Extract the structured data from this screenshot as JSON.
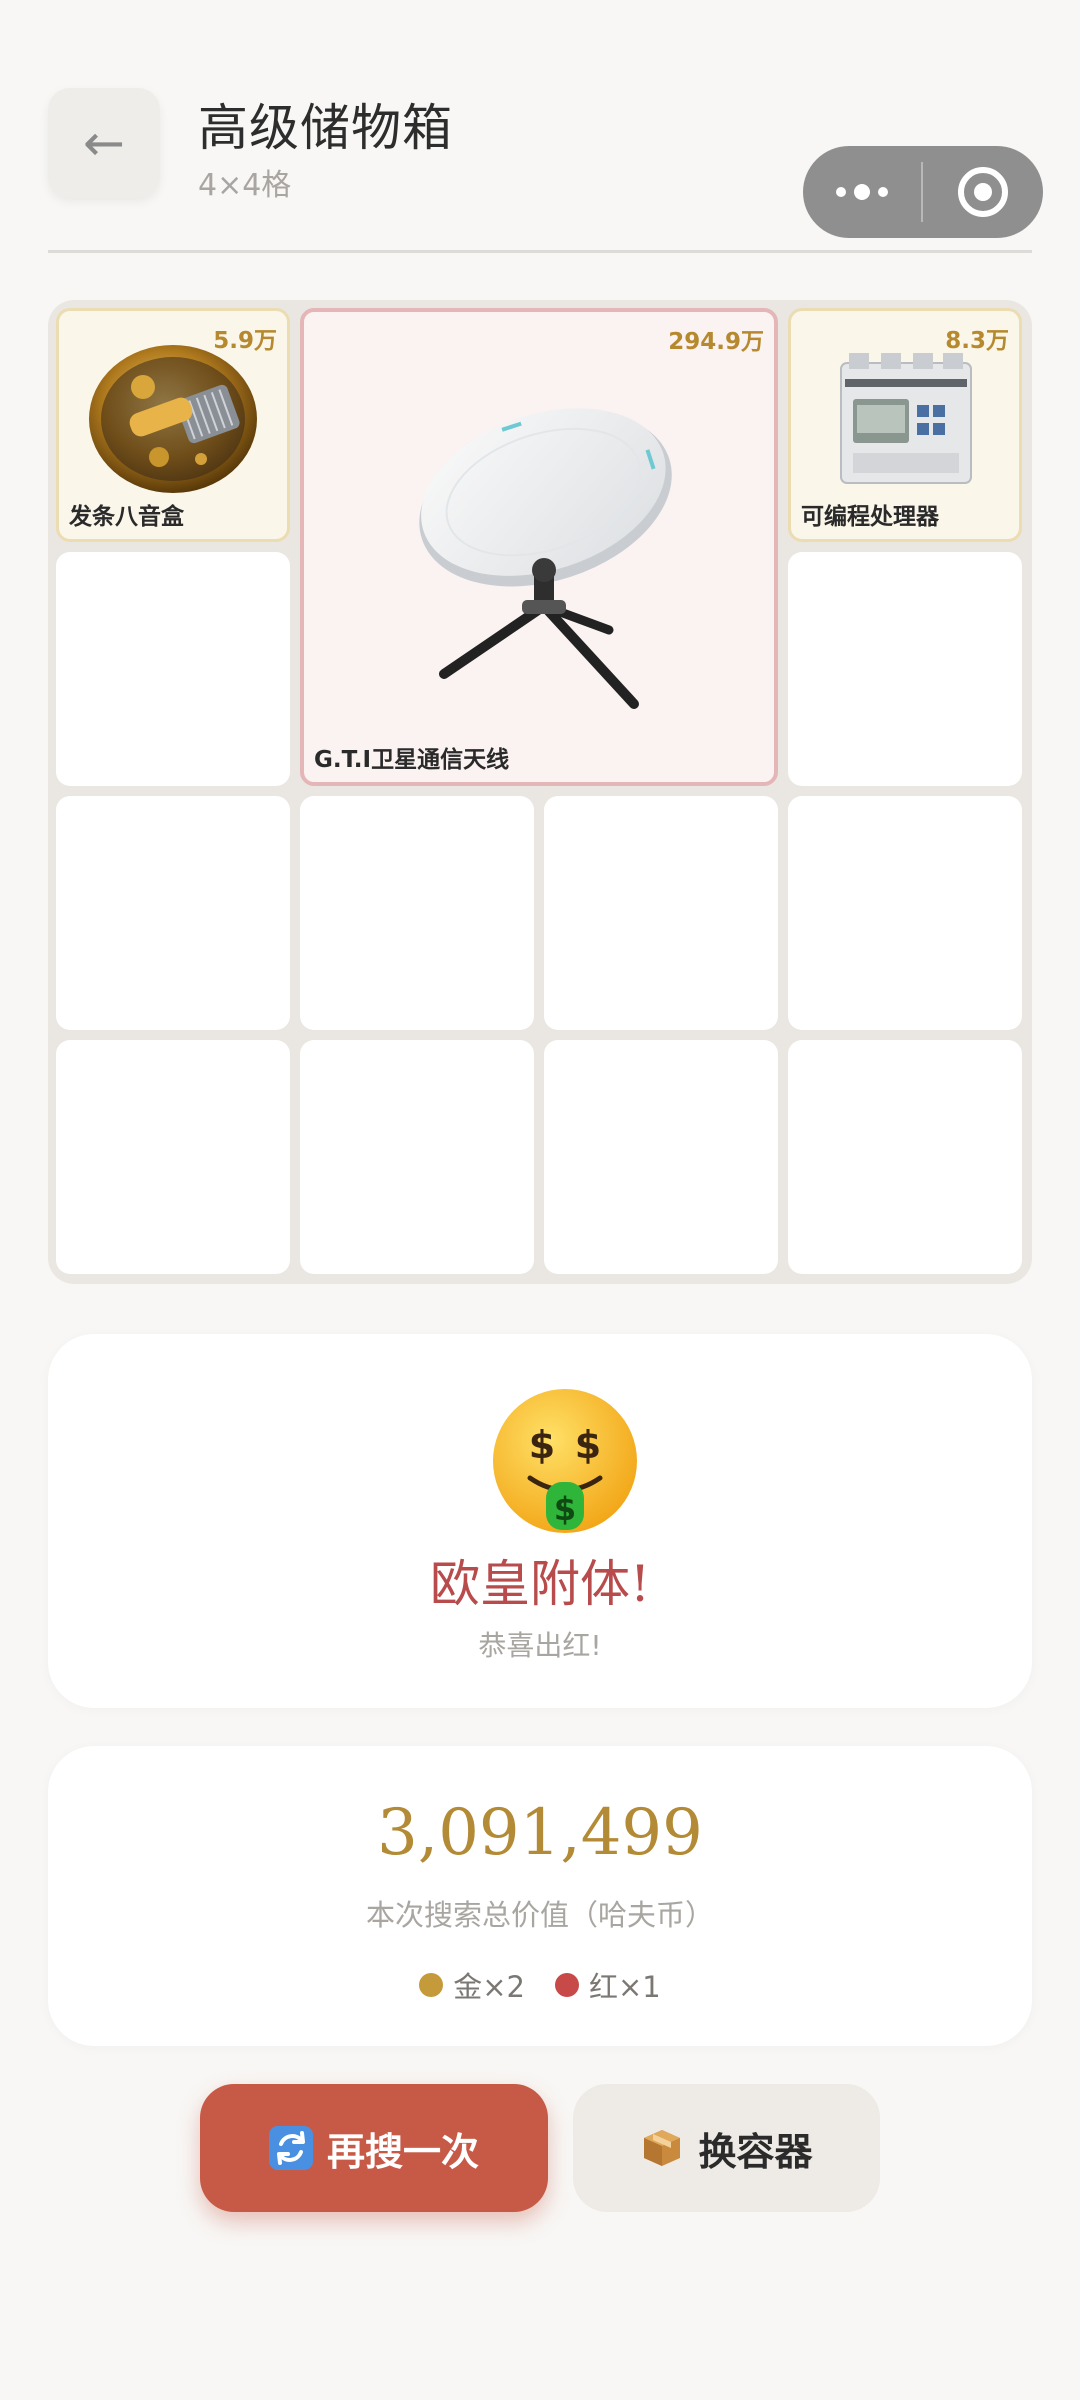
{
  "header": {
    "back_icon": "←",
    "title": "高级储物箱",
    "subtitle": "4×4格"
  },
  "grid": {
    "rows": 4,
    "cols": 4,
    "items": [
      {
        "name": "发条八音盒",
        "price": "5.9万",
        "rarity": "gold",
        "icon": "music-box-icon"
      },
      {
        "name": "G.T.I卫星通信天线",
        "price": "294.9万",
        "rarity": "red",
        "icon": "satellite-antenna-icon"
      },
      {
        "name": "可编程处理器",
        "price": "8.3万",
        "rarity": "gold",
        "icon": "processor-icon"
      }
    ]
  },
  "result": {
    "emoji": "money-mouth-face-icon",
    "title": "欧皇附体!",
    "subtitle": "恭喜出红!"
  },
  "summary": {
    "total": "3,091,499",
    "label": "本次搜索总价值（哈夫币）",
    "rarity_counts": [
      {
        "label": "金×2",
        "color": "#c49a3a"
      },
      {
        "label": "红×1",
        "color": "#c74a48"
      }
    ]
  },
  "actions": {
    "search_again": "再搜一次",
    "change_container": "换容器"
  },
  "colors": {
    "accent": "#c75a46",
    "gold": "#b6892e",
    "red_text": "#b84b4b"
  }
}
